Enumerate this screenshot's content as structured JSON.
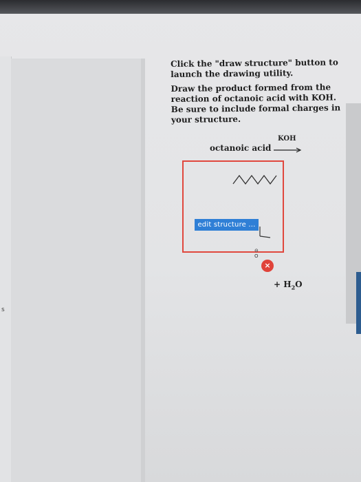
{
  "left_sidebar": {
    "mark": "s"
  },
  "question": {
    "line1": "Click the \"draw structure\" button to launch the drawing utility.",
    "line2": "Draw the product formed from the reaction of octanoic acid with KOH. Be sure to include formal charges in your structure."
  },
  "reaction": {
    "reactant": "octanoic acid",
    "reagent": "KOH",
    "byproduct_prefix": "+ H",
    "byproduct_sub": "2",
    "byproduct_suffix": "O",
    "product_charge_label": "⊖\nO"
  },
  "product_box": {
    "edit_button_label": "edit structure ...",
    "delete_icon": "close-icon",
    "border_color": "#e0473d"
  },
  "colors": {
    "button": "#2f7fd6",
    "delete": "#e0433a",
    "accent_strip": "#2d5c8f"
  }
}
